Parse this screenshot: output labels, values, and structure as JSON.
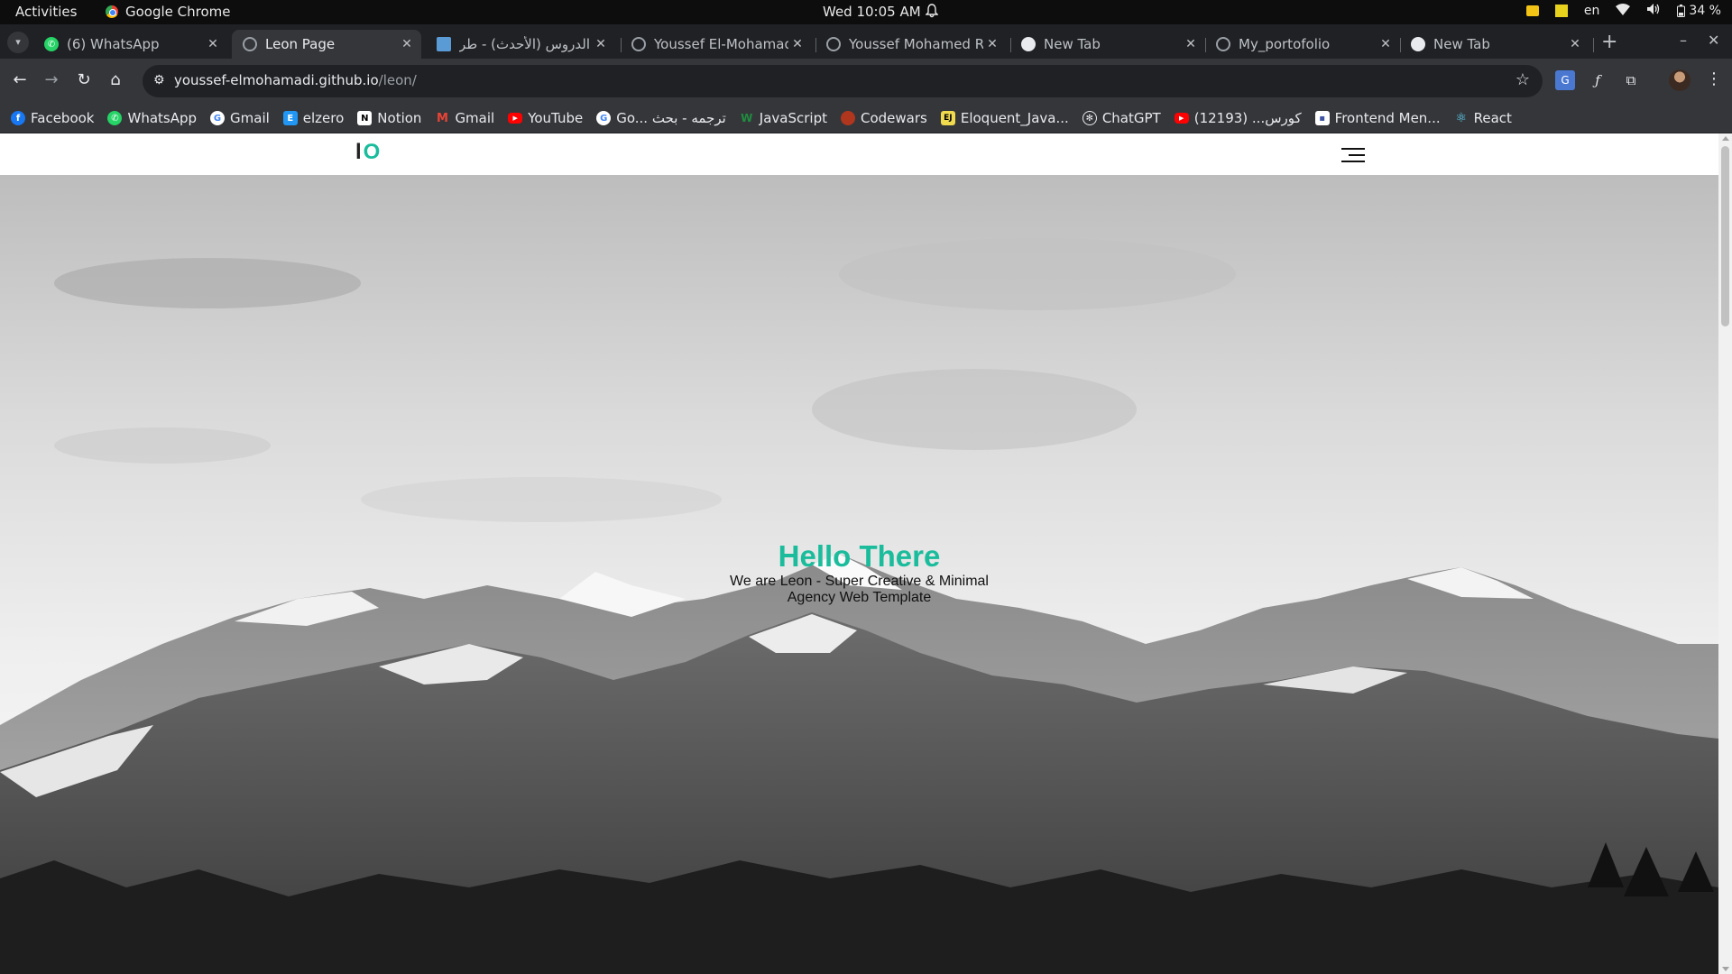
{
  "os_bar": {
    "activities": "Activities",
    "app_name": "Google Chrome",
    "clock": "Wed 10:05 AM",
    "lang": "en",
    "battery": "34 %"
  },
  "tabs": [
    {
      "title": "(6) WhatsApp",
      "icon": "whatsapp-icon",
      "active": false
    },
    {
      "title": "Leon Page",
      "icon": "globe-icon",
      "active": true
    },
    {
      "title": "الدروس (الأحدث) - طر",
      "icon": "doc-icon",
      "active": false
    },
    {
      "title": "Youssef El-Mohamadi",
      "icon": "globe-icon",
      "active": false
    },
    {
      "title": "Youssef Mohamed Ra",
      "icon": "globe-icon",
      "active": false
    },
    {
      "title": "New Tab",
      "icon": "chrome-icon",
      "active": false
    },
    {
      "title": "My_portofolio",
      "icon": "globe-icon",
      "active": false
    },
    {
      "title": "New Tab",
      "icon": "chrome-icon",
      "active": false
    }
  ],
  "omnibox": {
    "host": "youssef-elmohamadi.github.io",
    "path": "/leon/"
  },
  "bookmarks": [
    {
      "label": "Facebook",
      "icon": "facebook-icon",
      "color": "#1877f2"
    },
    {
      "label": "WhatsApp",
      "icon": "whatsapp-icon",
      "color": "#25d366"
    },
    {
      "label": "Gmail",
      "icon": "google-icon",
      "color": "#ffffff"
    },
    {
      "label": "elzero",
      "icon": "elzero-icon",
      "color": "#2196f3"
    },
    {
      "label": "Notion",
      "icon": "notion-icon",
      "color": "#ffffff"
    },
    {
      "label": "Gmail",
      "icon": "gmail-icon",
      "color": "#ea4335"
    },
    {
      "label": "YouTube",
      "icon": "youtube-icon",
      "color": "#ff0000"
    },
    {
      "label": "Go... ترجمه - بحث",
      "icon": "google-icon",
      "color": "#ffffff"
    },
    {
      "label": "JavaScript",
      "icon": "javascript-icon",
      "color": "#1e8e3e"
    },
    {
      "label": "Codewars",
      "icon": "codewars-icon",
      "color": "#b1361e"
    },
    {
      "label": "Eloquent_Java...",
      "icon": "eloquent-js-icon",
      "color": "#f0db4f"
    },
    {
      "label": "ChatGPT",
      "icon": "chatgpt-icon",
      "color": "#ffffff"
    },
    {
      "label": "كورس... (12193)",
      "icon": "youtube-icon",
      "color": "#ff0000"
    },
    {
      "label": "Frontend Men...",
      "icon": "frontend-mentor-icon",
      "color": "#ffffff"
    },
    {
      "label": "React",
      "icon": "react-icon",
      "color": "#61dafb"
    }
  ],
  "site": {
    "logo_l": "l",
    "logo_o": "O",
    "hero_title": "Hello There",
    "hero_subtitle": "We are Leon - Super Creative & Minimal Agency Web Template",
    "accent_color": "#1abc9c"
  }
}
